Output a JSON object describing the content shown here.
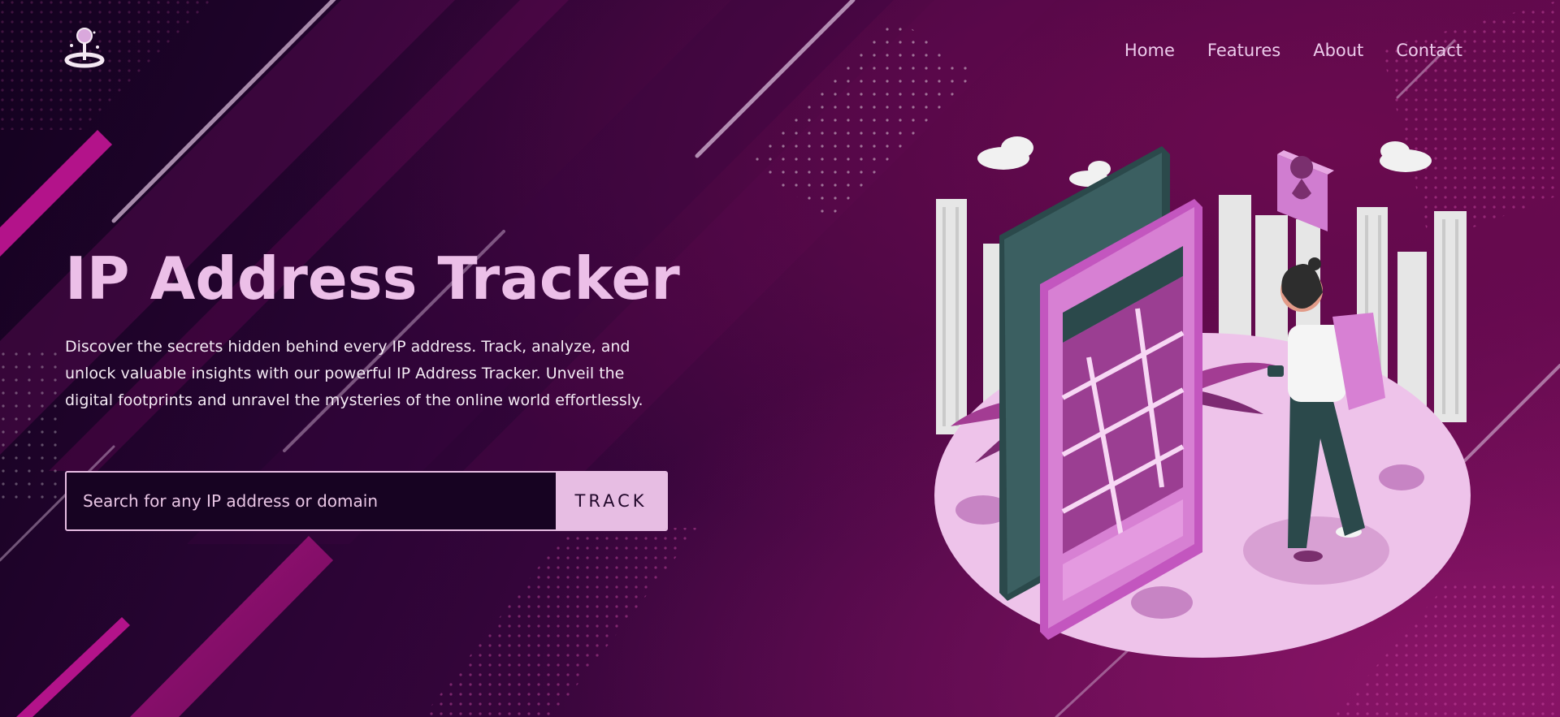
{
  "nav": {
    "items": [
      "Home",
      "Features",
      "About",
      "Contact"
    ]
  },
  "hero": {
    "title": "IP Address Tracker",
    "description": "Discover the secrets hidden behind every IP address. Track, analyze, and unlock valuable insights with our powerful IP Address Tracker. Unveil the digital footprints and unravel the mysteries of the online world effortlessly."
  },
  "search": {
    "placeholder": "Search for any IP address or domain",
    "button_label": "TRACK"
  },
  "icons": {
    "logo": "location-pin-icon"
  },
  "colors": {
    "accent": "#e7bde3",
    "title": "#ecbfe8",
    "background_dark": "#13021f",
    "background_magenta": "#6a0c55"
  }
}
